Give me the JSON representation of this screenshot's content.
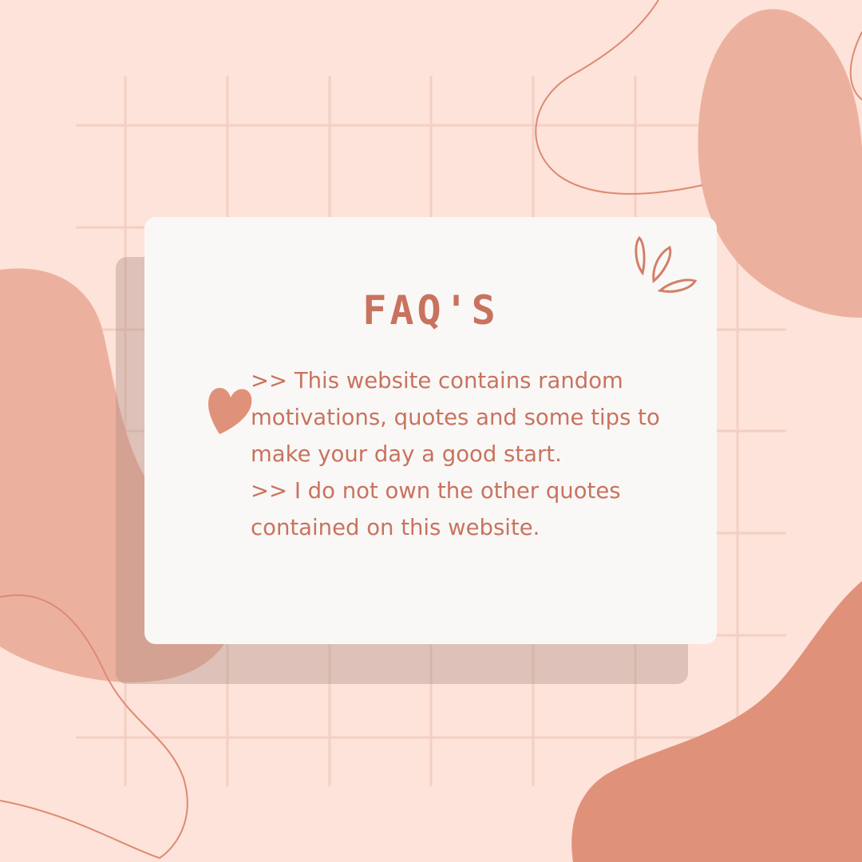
{
  "title": "FAQ'S",
  "items": [
    ">> This website contains random motivations, quotes and some tips to make your day a good start.",
    ">> I do not own the other quotes contained on this website."
  ],
  "colors": {
    "background": "#fde3da",
    "grid": "#f4cfc3",
    "blob_light": "#ecb19e",
    "blob_dark": "#e0917a",
    "accent_text": "#c8735f",
    "card": "#faf8f6"
  },
  "icons": [
    "heart-icon",
    "sparkle-icon"
  ]
}
